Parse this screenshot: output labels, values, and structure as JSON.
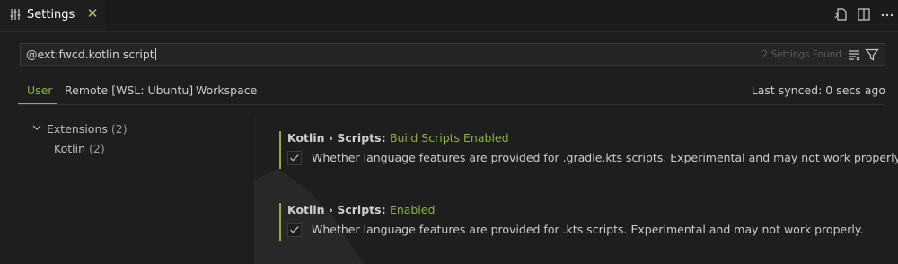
{
  "tab": {
    "title": "Settings",
    "close_glyph": "✕"
  },
  "actions": [
    "open-settings-json-icon",
    "split-editor-icon",
    "more-actions-icon"
  ],
  "search": {
    "query": "@ext:fwcd.kotlin script",
    "found": "2 Settings Found"
  },
  "scopes": [
    {
      "label": "User",
      "active": true
    },
    {
      "label": "Remote [WSL: Ubuntu]",
      "active": false
    },
    {
      "label": "Workspace",
      "active": false
    }
  ],
  "synced": "Last synced: 0 secs ago",
  "toc": {
    "extensions": {
      "label": "Extensions",
      "count": "(2)"
    },
    "kotlin": {
      "label": "Kotlin",
      "count": "(2)"
    }
  },
  "settings": [
    {
      "category": "Kotlin › Scripts: ",
      "name": "Build Scripts Enabled",
      "description": "Whether language features are provided for .gradle.kts scripts. Experimental and may not work properly.",
      "checked": true
    },
    {
      "category": "Kotlin › Scripts: ",
      "name": "Enabled",
      "description": "Whether language features are provided for .kts scripts. Experimental and may not work properly.",
      "checked": true
    }
  ],
  "colors": {
    "accent": "#8bb04a",
    "background": "#1e1e1e",
    "text": "#cccccc"
  }
}
